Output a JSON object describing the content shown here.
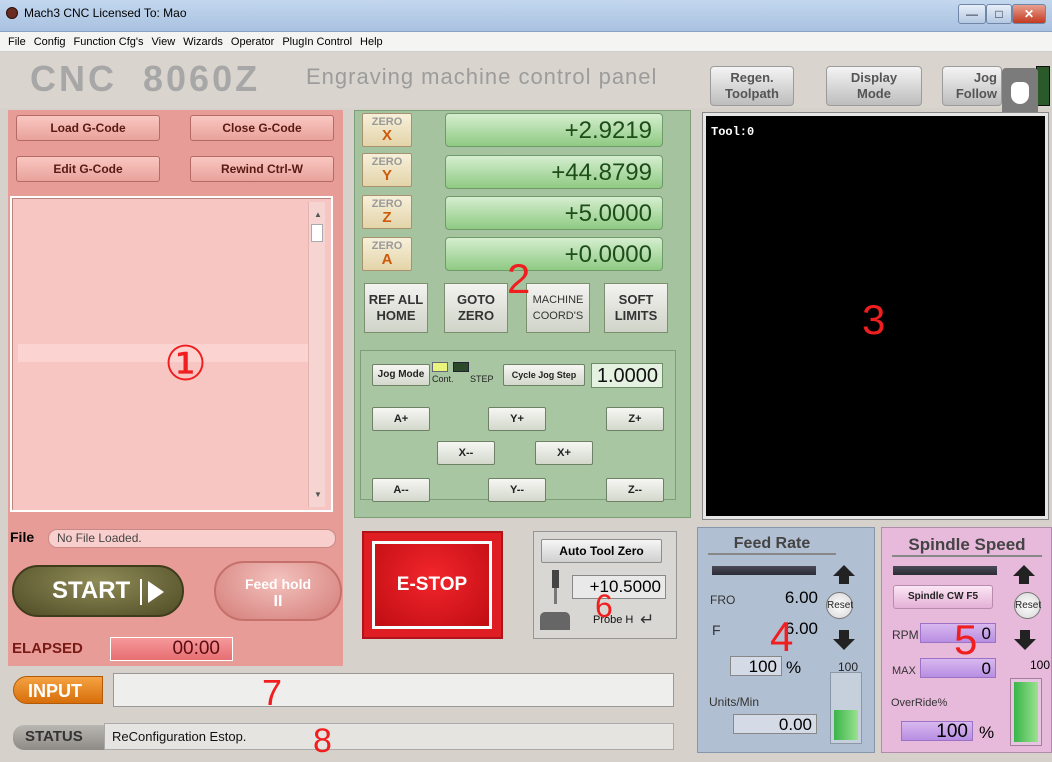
{
  "window": {
    "title": "Mach3 CNC  Licensed To: Mao",
    "controls": [
      "—",
      "□",
      "✕"
    ]
  },
  "menu": [
    "File",
    "Config",
    "Function Cfg's",
    "View",
    "Wizards",
    "Operator",
    "PlugIn Control",
    "Help"
  ],
  "header": {
    "brand": "CNC  8060Z",
    "subtitle": "Engraving machine control panel",
    "regen": [
      "Regen.",
      "Toolpath"
    ],
    "display": [
      "Display",
      "Mode"
    ],
    "jog": [
      "Jog",
      "Follow"
    ]
  },
  "program": {
    "load": "Load G-Code",
    "close": "Close G-Code",
    "edit": "Edit G-Code",
    "rewind": "Rewind Ctrl-W",
    "file_label": "File",
    "file_value": "No File Loaded.",
    "start": "START",
    "feedhold": "Feed hold",
    "feedhold_icon": "II",
    "elapsed_label": "ELAPSED",
    "elapsed_value": "00:00"
  },
  "dro": {
    "zero_label": "ZERO",
    "axes": [
      {
        "axis": "X",
        "value": "+2.9219"
      },
      {
        "axis": "Y",
        "value": "+44.8799"
      },
      {
        "axis": "Z",
        "value": "+5.0000"
      },
      {
        "axis": "A",
        "value": "+0.0000"
      }
    ]
  },
  "coord_buttons": [
    [
      "REF ALL",
      "HOME"
    ],
    [
      "GOTO",
      "ZERO"
    ],
    [
      "MACHINE",
      "COORD'S"
    ],
    [
      "SOFT",
      "LIMITS"
    ]
  ],
  "jog": {
    "mode": "Jog Mode",
    "cont": "Cont.",
    "step": "STEP",
    "cycle": "Cycle Jog Step",
    "value": "1.0000",
    "buttons": [
      "A+",
      "Y+",
      "Z+",
      "X--",
      "X+",
      "A--",
      "Y--",
      "Z--"
    ]
  },
  "toolpath": {
    "tool": "Tool:0"
  },
  "estop": "E-STOP",
  "toolzero": {
    "button": "Auto Tool Zero",
    "value": "+10.5000",
    "probe": "Probe H"
  },
  "feed": {
    "title": "Feed Rate",
    "fro_label": "FRO",
    "fro_value": "6.00",
    "f_label": "F",
    "f_value": "6.00",
    "percent": "100",
    "pct_sign": "%",
    "reset": "Reset",
    "max": "100",
    "units_label": "Units/Min",
    "units_value": "0.00"
  },
  "spindle": {
    "title": "Spindle Speed",
    "cw": "Spindle CW F5",
    "rpm_label": "RPM",
    "rpm_value": "0",
    "max_label": "MAX",
    "max_value": "0",
    "override_label": "OverRide%",
    "override_value": "100",
    "pct_sign": "%",
    "reset": "Reset",
    "max": "100"
  },
  "input": {
    "label": "INPUT",
    "value": ""
  },
  "status": {
    "label": "STATUS",
    "value": "ReConfiguration Estop."
  },
  "annotations": [
    "①",
    "2",
    "3",
    "4",
    "5",
    "6",
    "7",
    "8"
  ],
  "colors": {
    "program_panel": "#e89c98",
    "axis_panel": "#a5c39f",
    "feed_panel": "#b1bfd2",
    "spindle_panel": "#e7b9db",
    "estop": "#df1e24",
    "annotation": "#f01e1e"
  }
}
